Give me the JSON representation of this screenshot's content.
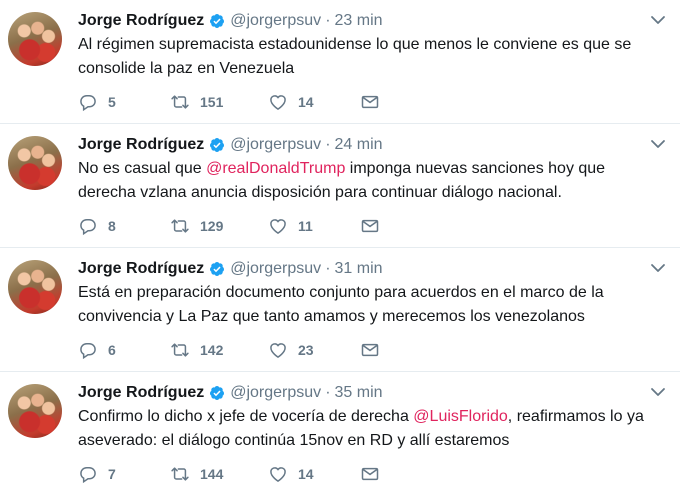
{
  "tweets": [
    {
      "name": "Jorge Rodríguez",
      "handle": "@jorgerpsuv",
      "sep": "·",
      "time": "23 min",
      "text_parts": [
        "Al régimen supremacista estadounidense lo que menos le conviene es que se consolide la paz en Venezuela",
        "",
        ""
      ],
      "replies": "5",
      "retweets": "151",
      "likes": "14"
    },
    {
      "name": "Jorge Rodríguez",
      "handle": "@jorgerpsuv",
      "sep": "·",
      "time": "24 min",
      "text_parts": [
        "No es casual que ",
        "@realDonaldTrump",
        " imponga nuevas sanciones hoy que derecha vzlana anuncia disposición para continuar diálogo nacional."
      ],
      "replies": "8",
      "retweets": "129",
      "likes": "11"
    },
    {
      "name": "Jorge Rodríguez",
      "handle": "@jorgerpsuv",
      "sep": "·",
      "time": "31 min",
      "text_parts": [
        "Está en preparación documento conjunto para acuerdos en el marco de la convivencia y La Paz que tanto amamos y merecemos los venezolanos",
        "",
        ""
      ],
      "replies": "6",
      "retweets": "142",
      "likes": "23"
    },
    {
      "name": "Jorge Rodríguez",
      "handle": "@jorgerpsuv",
      "sep": "·",
      "time": "35 min",
      "text_parts": [
        "Confirmo lo dicho x jefe de vocería de derecha ",
        "@LuisFlorido",
        ", reafirmamos lo ya aseverado: el diálogo continúa 15nov en RD y allí estaremos"
      ],
      "replies": "7",
      "retweets": "144",
      "likes": "14"
    }
  ],
  "icons": {
    "verified": "verified-badge-icon",
    "chevron": "chevron-down-icon",
    "reply": "reply-icon",
    "retweet": "retweet-icon",
    "like": "heart-icon",
    "dm": "envelope-icon"
  },
  "colors": {
    "accent_blue": "#1da1f2",
    "mention": "#e0245e",
    "muted": "#657786",
    "divider": "#e6ecf0"
  }
}
